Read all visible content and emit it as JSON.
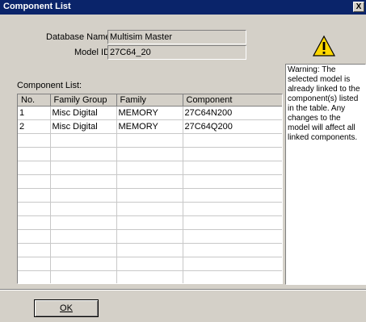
{
  "window": {
    "title": "Component List",
    "close_glyph": "X"
  },
  "form": {
    "database_name_label": "Database Name",
    "database_name_value": "Multisim Master",
    "model_id_label": "Model ID",
    "model_id_value": "27C64_20"
  },
  "component_list": {
    "label": "Component List:",
    "columns": [
      "No.",
      "Family Group",
      "Family",
      "Component"
    ],
    "rows": [
      [
        "1",
        "Misc Digital",
        "MEMORY",
        "27C64N200"
      ],
      [
        "2",
        "Misc Digital",
        "MEMORY",
        "27C64Q200"
      ]
    ]
  },
  "warning": {
    "icon": "warning-triangle-icon",
    "text": "Warning: The selected model is already linked to the component(s) listed in the table. Any changes to the model will affect all linked components."
  },
  "buttons": {
    "ok_label": "OK"
  },
  "colors": {
    "titlebar": "#0a246a",
    "window_face": "#d4d0c8",
    "warning_yellow": "#ffd800"
  }
}
